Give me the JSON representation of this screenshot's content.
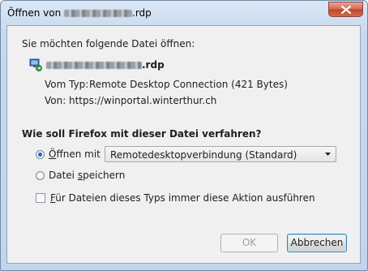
{
  "window": {
    "title_prefix": "Öffnen von",
    "title_suffix": ".rdp"
  },
  "dialog": {
    "intro": "Sie möchten folgende Datei öffnen:",
    "file_suffix": ".rdp",
    "type_label": "Vom Typ:",
    "type_value": "Remote Desktop Connection (421 Bytes)",
    "from_label": "Von:",
    "from_value": "https://winportal.winterthur.ch",
    "question": "Wie soll Firefox mit dieser Datei verfahren?",
    "open_with": {
      "label_access": "Ö",
      "label_rest": "ffnen mit",
      "checked": true
    },
    "app_select": {
      "value": "Remotedesktopverbindung (Standard)"
    },
    "save_file": {
      "label_pre": "Datei ",
      "label_access": "s",
      "label_rest": "peichern",
      "checked": false
    },
    "always": {
      "label_access": "F",
      "label_rest": "ür Dateien dieses Typs immer diese Aktion ausführen",
      "checked": false
    },
    "ok_label": "OK",
    "cancel_label": "Abbrechen"
  },
  "icons": {
    "file": "remote-desktop-file-icon",
    "close": "close-icon",
    "dropdown": "chevron-down-icon"
  }
}
